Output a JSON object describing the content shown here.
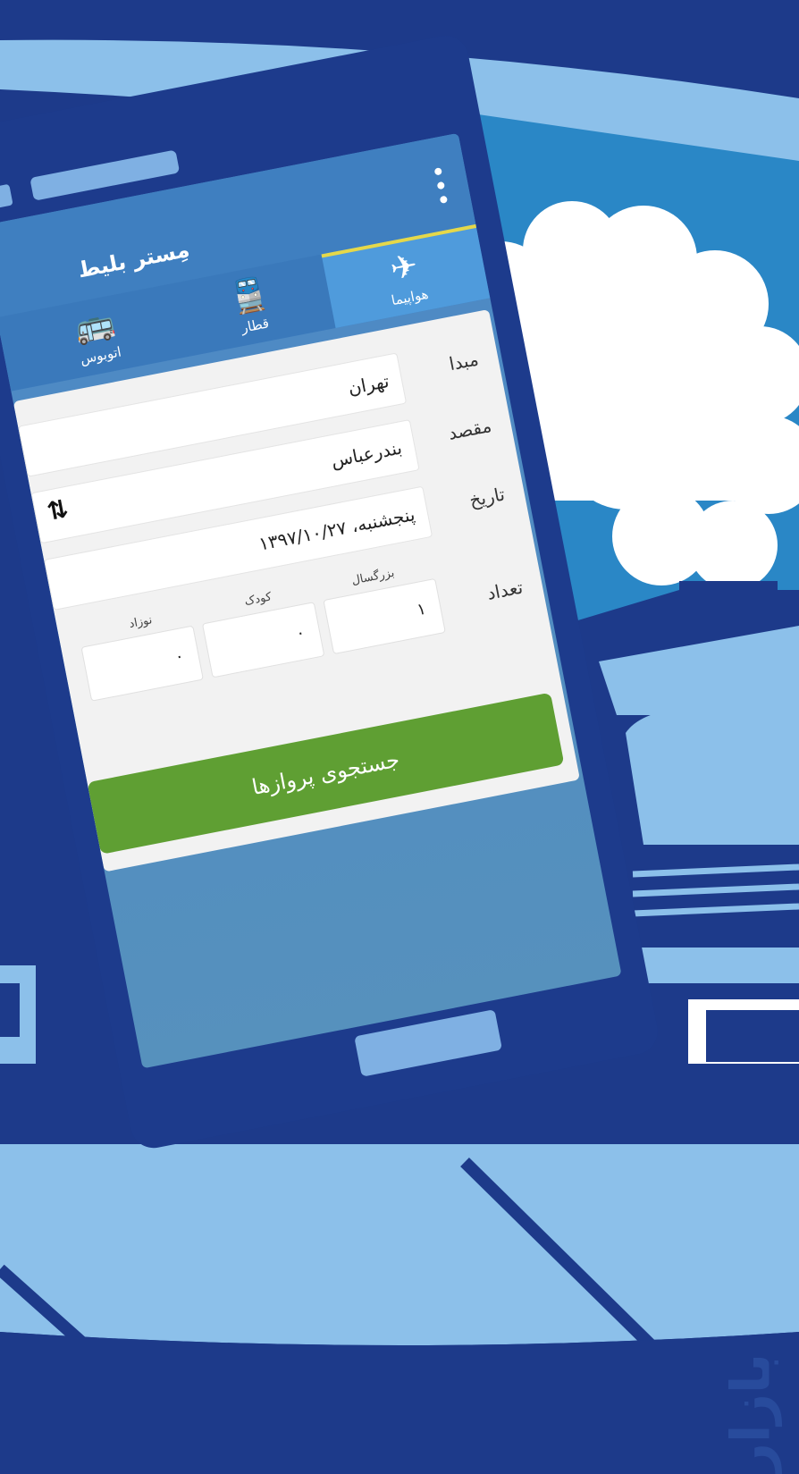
{
  "app": {
    "title": "مِستر بلیط",
    "menu_icon": "more-vertical-icon"
  },
  "tabs": [
    {
      "label": "هواپیما",
      "icon": "airplane-icon",
      "active": true
    },
    {
      "label": "قطار",
      "icon": "train-icon",
      "active": false
    },
    {
      "label": "اتوبوس",
      "icon": "bus-icon",
      "active": false
    }
  ],
  "form": {
    "origin_label": "مبدا",
    "origin_value": "تهران",
    "destination_label": "مقصد",
    "destination_value": "بندرعباس",
    "swap_icon": "swap-arrows-icon",
    "date_label": "تاریخ",
    "date_value": "پنجشنبه، ۱۳۹۷/۱۰/۲۷",
    "count_label": "تعداد",
    "adult_label": "بزرگسال",
    "adult_value": "۱",
    "child_label": "کودک",
    "child_value": "۰",
    "infant_label": "نوزاد",
    "infant_value": "۰",
    "search_button": "جستجوی پروازها"
  },
  "store_logo": "بازار",
  "colors": {
    "background": "#1d3a8a",
    "sky": "#2a87c6",
    "accent_green": "#5f9f33",
    "tab_indicator": "#e5d84a"
  }
}
